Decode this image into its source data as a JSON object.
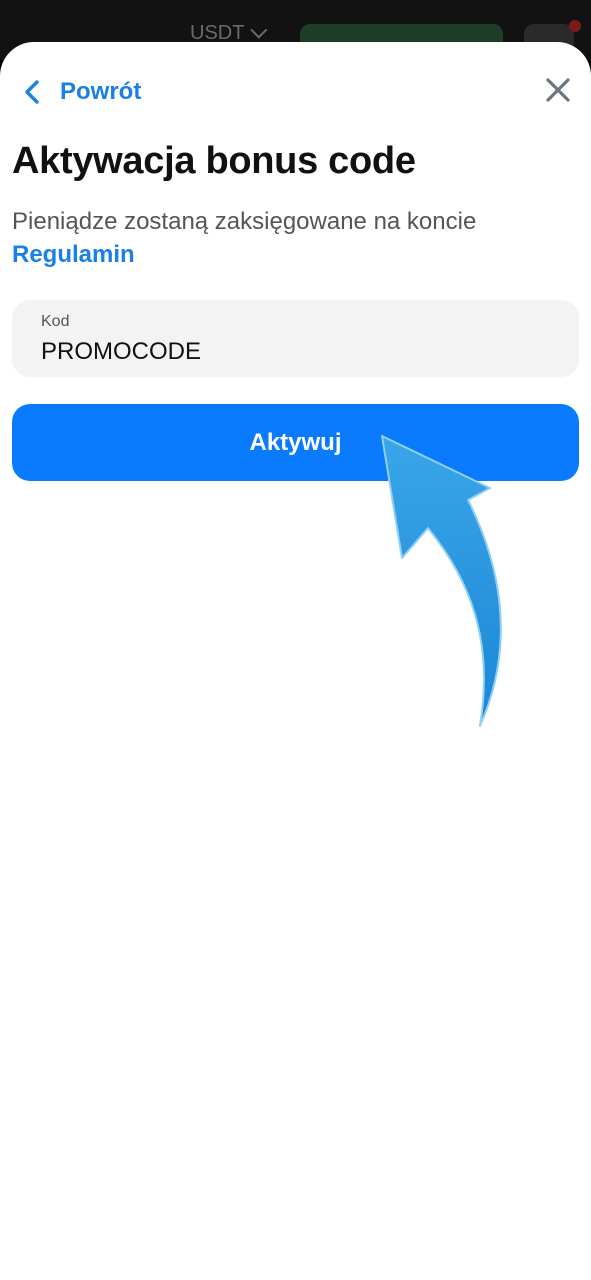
{
  "background": {
    "currency": "USDT"
  },
  "header": {
    "back_label": "Powrót"
  },
  "page": {
    "title": "Aktywacja bonus code",
    "subtitle": "Pieniądze zostaną zaksięgowane na koncie",
    "terms_link": "Regulamin"
  },
  "form": {
    "code_label": "Kod",
    "code_value": "PROMOCODE",
    "submit_label": "Aktywuj"
  },
  "icons": {
    "back": "chevron-left-icon",
    "close": "close-icon",
    "annotation": "curved-arrow-icon"
  },
  "colors": {
    "accent": "#0a7bff",
    "link": "#1a7fe6",
    "field_bg": "#f3f3f3",
    "arrow": "#1f8fdc"
  }
}
